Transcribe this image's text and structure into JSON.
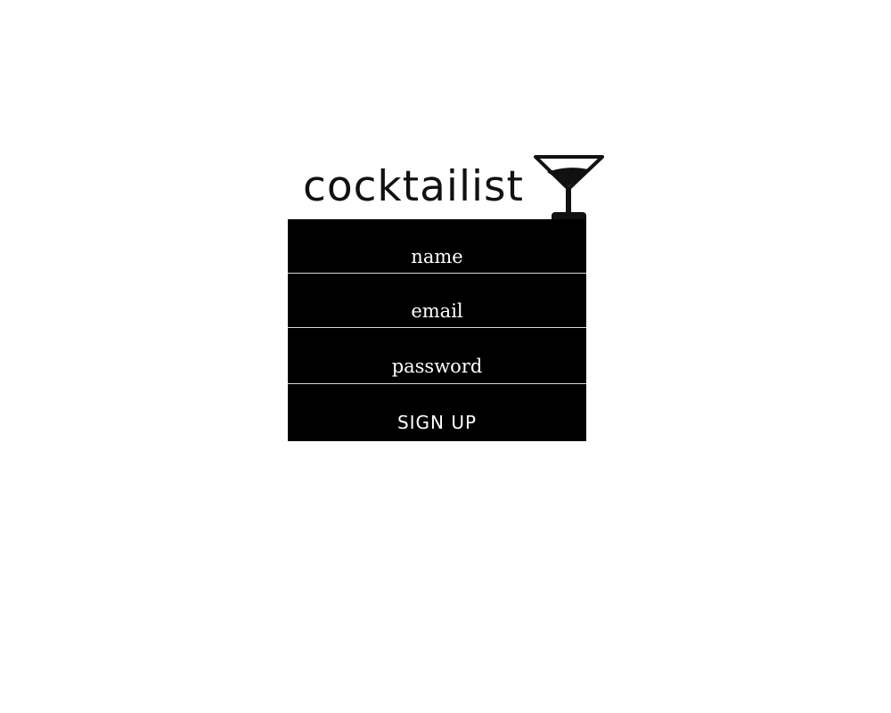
{
  "brand": {
    "name": "cocktailist"
  },
  "signup_form": {
    "name_placeholder": "name",
    "email_placeholder": "email",
    "password_placeholder": "password",
    "submit_label": "SIGN UP"
  },
  "icons": {
    "logo_glass": "martini-glass-icon"
  },
  "colors": {
    "form_background": "#000000",
    "form_text": "#ffffff",
    "divider": "#d8d8d8",
    "logo_text": "#111111"
  }
}
